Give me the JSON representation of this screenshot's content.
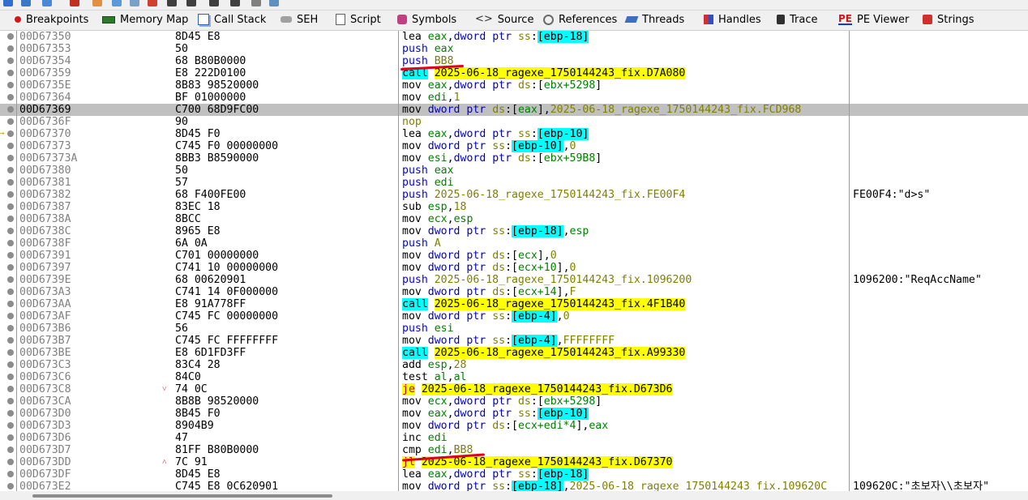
{
  "tabs": [
    {
      "label": "Breakpoints",
      "icon": "breakpoint-dot-icon"
    },
    {
      "label": "Memory Map",
      "icon": "memory-chip-icon"
    },
    {
      "label": "Call Stack",
      "icon": "call-stack-icon"
    },
    {
      "label": "SEH",
      "icon": "seh-chain-icon"
    },
    {
      "label": "Script",
      "icon": "script-document-icon"
    },
    {
      "label": "Symbols",
      "icon": "symbols-cube-icon"
    },
    {
      "label": "Source",
      "icon": "source-code-icon"
    },
    {
      "label": "References",
      "icon": "references-magnifier-icon"
    },
    {
      "label": "Threads",
      "icon": "threads-arrows-icon"
    },
    {
      "label": "Handles",
      "icon": "handles-blocks-icon"
    },
    {
      "label": "Trace",
      "icon": "trace-walker-icon"
    },
    {
      "label": "PE Viewer",
      "icon": "pe-viewer-icon",
      "icon_text": "PE"
    },
    {
      "label": "Strings",
      "icon": "strings-quote-icon"
    }
  ],
  "selected_address": "00D67369",
  "rows": [
    {
      "addr": "00D67350",
      "bytes": "8D45 E8",
      "dis": [
        [
          "lea",
          "mn"
        ],
        [
          " ",
          "op"
        ],
        [
          "eax",
          "reg"
        ],
        [
          ",",
          "op"
        ],
        [
          "dword ptr",
          "kw"
        ],
        [
          " ",
          "op"
        ],
        [
          "ss",
          "seg"
        ],
        [
          ":",
          "op"
        ],
        [
          "[",
          "brk"
        ],
        [
          "ebp-18",
          "brk"
        ],
        [
          "]",
          "brk"
        ]
      ]
    },
    {
      "addr": "00D67353",
      "bytes": "50",
      "dis": [
        [
          "push",
          "mnb"
        ],
        [
          " ",
          "op"
        ],
        [
          "eax",
          "reg"
        ]
      ]
    },
    {
      "addr": "00D67354",
      "bytes": "68 B80B0000",
      "dis": [
        [
          "push",
          "mnb"
        ],
        [
          " ",
          "op"
        ],
        [
          "BB8",
          "num"
        ]
      ]
    },
    {
      "addr": "00D67359",
      "bytes": "E8 222D0100",
      "dis": [
        [
          "call",
          "call"
        ],
        [
          " ",
          "op"
        ],
        [
          "2025-06-18_ragexe_1750144243_fix.D7A080",
          "tgt"
        ]
      ]
    },
    {
      "addr": "00D6735E",
      "bytes": "8B83 98520000",
      "dis": [
        [
          "mov",
          "mn"
        ],
        [
          " ",
          "op"
        ],
        [
          "eax",
          "reg"
        ],
        [
          ",",
          "op"
        ],
        [
          "dword ptr",
          "kw"
        ],
        [
          " ",
          "op"
        ],
        [
          "ds",
          "seg"
        ],
        [
          ":[",
          "op"
        ],
        [
          "ebx+5298",
          "reg"
        ],
        [
          "]",
          "op"
        ]
      ]
    },
    {
      "addr": "00D67364",
      "bytes": "BF 01000000",
      "dis": [
        [
          "mov",
          "mn"
        ],
        [
          " ",
          "op"
        ],
        [
          "edi",
          "reg"
        ],
        [
          ",",
          "op"
        ],
        [
          "1",
          "num"
        ]
      ]
    },
    {
      "addr": "00D67369",
      "bytes": "C700 68D9FC00",
      "sel": true,
      "dis": [
        [
          "mov",
          "mn"
        ],
        [
          " ",
          "op"
        ],
        [
          "dword ptr",
          "kw"
        ],
        [
          " ",
          "op"
        ],
        [
          "ds",
          "seg"
        ],
        [
          ":[",
          "op"
        ],
        [
          "eax",
          "reg"
        ],
        [
          "],",
          "op"
        ],
        [
          "2025-06-18_ragexe_1750144243_fix.FCD968",
          "sym"
        ]
      ]
    },
    {
      "addr": "00D6736F",
      "bytes": "90",
      "dis": [
        [
          "nop",
          "nop"
        ]
      ]
    },
    {
      "addr": "00D67370",
      "bytes": "8D45 F0",
      "jtarget": true,
      "dis": [
        [
          "lea",
          "mn"
        ],
        [
          " ",
          "op"
        ],
        [
          "eax",
          "reg"
        ],
        [
          ",",
          "op"
        ],
        [
          "dword ptr",
          "kw"
        ],
        [
          " ",
          "op"
        ],
        [
          "ss",
          "seg"
        ],
        [
          ":",
          "op"
        ],
        [
          "[",
          "brk"
        ],
        [
          "ebp-10",
          "brk"
        ],
        [
          "]",
          "brk"
        ]
      ]
    },
    {
      "addr": "00D67373",
      "bytes": "C745 F0 00000000",
      "dis": [
        [
          "mov",
          "mn"
        ],
        [
          " ",
          "op"
        ],
        [
          "dword ptr",
          "kw"
        ],
        [
          " ",
          "op"
        ],
        [
          "ss",
          "seg"
        ],
        [
          ":",
          "op"
        ],
        [
          "[",
          "brk"
        ],
        [
          "ebp-10",
          "brk"
        ],
        [
          "]",
          "brk"
        ],
        [
          ",",
          "op"
        ],
        [
          "0",
          "num"
        ]
      ]
    },
    {
      "addr": "00D67373A",
      "bytes": "8BB3 B8590000",
      "dis": [
        [
          "mov",
          "mn"
        ],
        [
          " ",
          "op"
        ],
        [
          "esi",
          "reg"
        ],
        [
          ",",
          "op"
        ],
        [
          "dword ptr",
          "kw"
        ],
        [
          " ",
          "op"
        ],
        [
          "ds",
          "seg"
        ],
        [
          ":[",
          "op"
        ],
        [
          "ebx+59B8",
          "reg"
        ],
        [
          "]",
          "op"
        ]
      ]
    },
    {
      "addr": "00D67380",
      "bytes": "50",
      "dis": [
        [
          "push",
          "mnb"
        ],
        [
          " ",
          "op"
        ],
        [
          "eax",
          "reg"
        ]
      ]
    },
    {
      "addr": "00D67381",
      "bytes": "57",
      "dis": [
        [
          "push",
          "mnb"
        ],
        [
          " ",
          "op"
        ],
        [
          "edi",
          "reg"
        ]
      ]
    },
    {
      "addr": "00D67382",
      "bytes": "68 F400FE00",
      "comment": "FE00F4:\"d>s\"",
      "dis": [
        [
          "push",
          "mnb"
        ],
        [
          " ",
          "op"
        ],
        [
          "2025-06-18_ragexe_1750144243_fix.FE00F4",
          "sym"
        ]
      ]
    },
    {
      "addr": "00D67387",
      "bytes": "83EC 18",
      "dis": [
        [
          "sub",
          "mn"
        ],
        [
          " ",
          "op"
        ],
        [
          "esp",
          "reg"
        ],
        [
          ",",
          "op"
        ],
        [
          "18",
          "num"
        ]
      ]
    },
    {
      "addr": "00D6738A",
      "bytes": "8BCC",
      "dis": [
        [
          "mov",
          "mn"
        ],
        [
          " ",
          "op"
        ],
        [
          "ecx",
          "reg"
        ],
        [
          ",",
          "op"
        ],
        [
          "esp",
          "reg"
        ]
      ]
    },
    {
      "addr": "00D6738C",
      "bytes": "8965 E8",
      "dis": [
        [
          "mov",
          "mn"
        ],
        [
          " ",
          "op"
        ],
        [
          "dword ptr",
          "kw"
        ],
        [
          " ",
          "op"
        ],
        [
          "ss",
          "seg"
        ],
        [
          ":",
          "op"
        ],
        [
          "[",
          "brk"
        ],
        [
          "ebp-18",
          "brk"
        ],
        [
          "]",
          "brk"
        ],
        [
          ",",
          "op"
        ],
        [
          "esp",
          "reg"
        ]
      ]
    },
    {
      "addr": "00D6738F",
      "bytes": "6A 0A",
      "dis": [
        [
          "push",
          "mnb"
        ],
        [
          " ",
          "op"
        ],
        [
          "A",
          "num"
        ]
      ]
    },
    {
      "addr": "00D67391",
      "bytes": "C701 00000000",
      "dis": [
        [
          "mov",
          "mn"
        ],
        [
          " ",
          "op"
        ],
        [
          "dword ptr",
          "kw"
        ],
        [
          " ",
          "op"
        ],
        [
          "ds",
          "seg"
        ],
        [
          ":[",
          "op"
        ],
        [
          "ecx",
          "reg"
        ],
        [
          "],",
          "op"
        ],
        [
          "0",
          "num"
        ]
      ]
    },
    {
      "addr": "00D67397",
      "bytes": "C741 10 00000000",
      "dis": [
        [
          "mov",
          "mn"
        ],
        [
          " ",
          "op"
        ],
        [
          "dword ptr",
          "kw"
        ],
        [
          " ",
          "op"
        ],
        [
          "ds",
          "seg"
        ],
        [
          ":[",
          "op"
        ],
        [
          "ecx+10",
          "reg"
        ],
        [
          "],",
          "op"
        ],
        [
          "0",
          "num"
        ]
      ]
    },
    {
      "addr": "00D6739E",
      "bytes": "68 00620901",
      "comment": "1096200:\"ReqAccName\"",
      "dis": [
        [
          "push",
          "mnb"
        ],
        [
          " ",
          "op"
        ],
        [
          "2025-06-18_ragexe_1750144243_fix.1096200",
          "sym"
        ]
      ]
    },
    {
      "addr": "00D673A3",
      "bytes": "C741 14 0F000000",
      "dis": [
        [
          "mov",
          "mn"
        ],
        [
          " ",
          "op"
        ],
        [
          "dword ptr",
          "kw"
        ],
        [
          " ",
          "op"
        ],
        [
          "ds",
          "seg"
        ],
        [
          ":[",
          "op"
        ],
        [
          "ecx+14",
          "reg"
        ],
        [
          "],",
          "op"
        ],
        [
          "F",
          "num"
        ]
      ]
    },
    {
      "addr": "00D673AA",
      "bytes": "E8 91A778FF",
      "dis": [
        [
          "call",
          "call"
        ],
        [
          " ",
          "op"
        ],
        [
          "2025-06-18_ragexe_1750144243_fix.4F1B40",
          "tgt"
        ]
      ]
    },
    {
      "addr": "00D673AF",
      "bytes": "C745 FC 00000000",
      "dis": [
        [
          "mov",
          "mn"
        ],
        [
          " ",
          "op"
        ],
        [
          "dword ptr",
          "kw"
        ],
        [
          " ",
          "op"
        ],
        [
          "ss",
          "seg"
        ],
        [
          ":",
          "op"
        ],
        [
          "[",
          "brk"
        ],
        [
          "ebp-4",
          "brk"
        ],
        [
          "]",
          "brk"
        ],
        [
          ",",
          "op"
        ],
        [
          "0",
          "num"
        ]
      ]
    },
    {
      "addr": "00D673B6",
      "bytes": "56",
      "dis": [
        [
          "push",
          "mnb"
        ],
        [
          " ",
          "op"
        ],
        [
          "esi",
          "reg"
        ]
      ]
    },
    {
      "addr": "00D673B7",
      "bytes": "C745 FC FFFFFFFF",
      "dis": [
        [
          "mov",
          "mn"
        ],
        [
          " ",
          "op"
        ],
        [
          "dword ptr",
          "kw"
        ],
        [
          " ",
          "op"
        ],
        [
          "ss",
          "seg"
        ],
        [
          ":",
          "op"
        ],
        [
          "[",
          "brk"
        ],
        [
          "ebp-4",
          "brk"
        ],
        [
          "]",
          "brk"
        ],
        [
          ",",
          "op"
        ],
        [
          "FFFFFFFF",
          "num"
        ]
      ]
    },
    {
      "addr": "00D673BE",
      "bytes": "E8 6D1FD3FF",
      "dis": [
        [
          "call",
          "call"
        ],
        [
          " ",
          "op"
        ],
        [
          "2025-06-18_ragexe_1750144243_fix.A99330",
          "tgt"
        ]
      ]
    },
    {
      "addr": "00D673C3",
      "bytes": "83C4 28",
      "dis": [
        [
          "add",
          "mn"
        ],
        [
          " ",
          "op"
        ],
        [
          "esp",
          "reg"
        ],
        [
          ",",
          "op"
        ],
        [
          "28",
          "num"
        ]
      ]
    },
    {
      "addr": "00D673C6",
      "bytes": "84C0",
      "dis": [
        [
          "test",
          "mn"
        ],
        [
          " ",
          "op"
        ],
        [
          "al",
          "reg"
        ],
        [
          ",",
          "op"
        ],
        [
          "al",
          "reg"
        ]
      ]
    },
    {
      "addr": "00D673C8",
      "bytes": "74 0C",
      "jmark": "˅",
      "dis": [
        [
          "je",
          "jcc"
        ],
        [
          " ",
          "op"
        ],
        [
          "2025-06-18_ragexe_1750144243_fix.D673D6",
          "tgt"
        ]
      ]
    },
    {
      "addr": "00D673CA",
      "bytes": "8B8B 98520000",
      "dis": [
        [
          "mov",
          "mn"
        ],
        [
          " ",
          "op"
        ],
        [
          "ecx",
          "reg"
        ],
        [
          ",",
          "op"
        ],
        [
          "dword ptr",
          "kw"
        ],
        [
          " ",
          "op"
        ],
        [
          "ds",
          "seg"
        ],
        [
          ":[",
          "op"
        ],
        [
          "ebx+5298",
          "reg"
        ],
        [
          "]",
          "op"
        ]
      ]
    },
    {
      "addr": "00D673D0",
      "bytes": "8B45 F0",
      "dis": [
        [
          "mov",
          "mn"
        ],
        [
          " ",
          "op"
        ],
        [
          "eax",
          "reg"
        ],
        [
          ",",
          "op"
        ],
        [
          "dword ptr",
          "kw"
        ],
        [
          " ",
          "op"
        ],
        [
          "ss",
          "seg"
        ],
        [
          ":",
          "op"
        ],
        [
          "[",
          "brk"
        ],
        [
          "ebp-10",
          "brk"
        ],
        [
          "]",
          "brk"
        ]
      ]
    },
    {
      "addr": "00D673D3",
      "bytes": "8904B9",
      "dis": [
        [
          "mov",
          "mn"
        ],
        [
          " ",
          "op"
        ],
        [
          "dword ptr",
          "kw"
        ],
        [
          " ",
          "op"
        ],
        [
          "ds",
          "seg"
        ],
        [
          ":[",
          "op"
        ],
        [
          "ecx+edi*4",
          "reg"
        ],
        [
          "],",
          "op"
        ],
        [
          "eax",
          "reg"
        ]
      ]
    },
    {
      "addr": "00D673D6",
      "bytes": "47",
      "dis": [
        [
          "inc",
          "mn"
        ],
        [
          " ",
          "op"
        ],
        [
          "edi",
          "reg"
        ]
      ]
    },
    {
      "addr": "00D673D7",
      "bytes": "81FF B80B0000",
      "dis": [
        [
          "cmp",
          "mn"
        ],
        [
          " ",
          "op"
        ],
        [
          "edi",
          "reg"
        ],
        [
          ",",
          "op"
        ],
        [
          "BB8",
          "num"
        ]
      ]
    },
    {
      "addr": "00D673DD",
      "bytes": "7C 91",
      "jmark": "˄",
      "dis": [
        [
          "jl",
          "jcc"
        ],
        [
          " ",
          "op"
        ],
        [
          "2025-06-18_ragexe_1750144243_fix.D67370",
          "tgt"
        ]
      ]
    },
    {
      "addr": "00D673DF",
      "bytes": "8D45 E8",
      "dis": [
        [
          "lea",
          "mn"
        ],
        [
          " ",
          "op"
        ],
        [
          "eax",
          "reg"
        ],
        [
          ",",
          "op"
        ],
        [
          "dword ptr",
          "kw"
        ],
        [
          " ",
          "op"
        ],
        [
          "ss",
          "seg"
        ],
        [
          ":",
          "op"
        ],
        [
          "[",
          "brk"
        ],
        [
          "ebp-18",
          "brk"
        ],
        [
          "]",
          "brk"
        ]
      ]
    },
    {
      "addr": "00D673E2",
      "bytes": "C745 E8 0C620901",
      "comment": "109620C:\"초보자\\\\초보자\"",
      "dis": [
        [
          "mov",
          "mn"
        ],
        [
          " ",
          "op"
        ],
        [
          "dword ptr",
          "kw"
        ],
        [
          " ",
          "op"
        ],
        [
          "ss",
          "seg"
        ],
        [
          ":",
          "op"
        ],
        [
          "[",
          "brk"
        ],
        [
          "ebp-18",
          "brk"
        ],
        [
          "]",
          "brk"
        ],
        [
          ",",
          "op"
        ],
        [
          "2025-06-18_ragexe_1750144243_fix.109620C",
          "sym"
        ]
      ]
    }
  ]
}
